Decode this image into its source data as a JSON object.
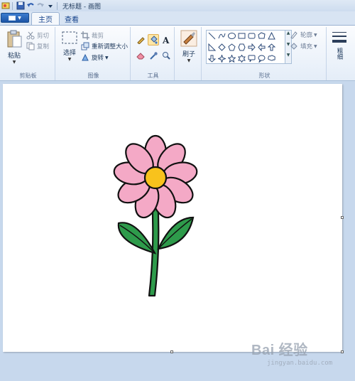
{
  "window": {
    "title": "无标题 - 画图"
  },
  "tabs": [
    {
      "label": "主页",
      "active": true
    },
    {
      "label": "查看",
      "active": false
    }
  ],
  "ribbon": {
    "clipboard": {
      "label": "剪贴板",
      "paste": "粘贴",
      "cut": "剪切",
      "copy": "复制"
    },
    "image": {
      "label": "图像",
      "select": "选择",
      "crop": "裁剪",
      "resize": "重新调整大小",
      "rotate": "旋转"
    },
    "tools": {
      "label": "工具",
      "items": [
        "pencil-icon",
        "fill-icon",
        "text-icon",
        "eraser-icon",
        "color-picker-icon",
        "magnifier-icon"
      ],
      "selected": "fill-icon"
    },
    "brushes": {
      "label": "刷子"
    },
    "shapes": {
      "label": "形状",
      "outline": "轮廓",
      "fill": "填充"
    },
    "size": {
      "label": "粗细"
    }
  },
  "canvas": {
    "background": "#ffffff",
    "drawing": {
      "petal_color": "#f4a9c6",
      "center_color": "#f8c21c",
      "leaf_color": "#2e9b4b",
      "stem_color": "#2e9b4b",
      "outline_color": "#111111"
    }
  },
  "watermark": {
    "main": "Bai 经验",
    "sub": "jingyan.baidu.com"
  },
  "colors": {
    "accent": "#1d55a6",
    "ribbon_bg": "#e4edf8",
    "workspace_bg": "#c7d8ed",
    "selected_tool": "#fde6a6"
  }
}
